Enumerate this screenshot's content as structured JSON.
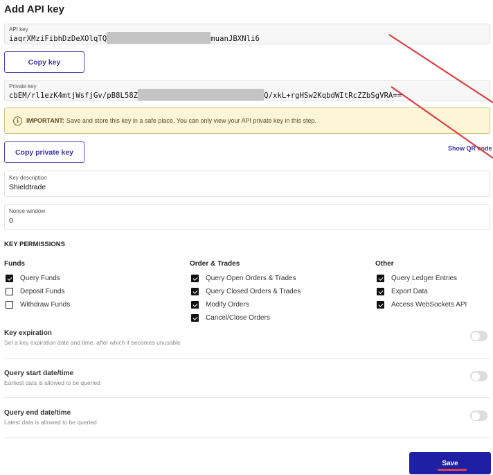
{
  "page": {
    "title": "Add API key"
  },
  "api_key": {
    "label": "API key",
    "value_start": "iaqrXMziFibhDzDeXOlqTQ",
    "value_end": "muanJBXNli6",
    "copy_button": "Copy key"
  },
  "private_key": {
    "label": "Private key",
    "value_start": "cbEM/rl1ezK4mtjWsfjGv/pB8L58Z",
    "value_end": "Q/xkL+rgHSw2KqbdWItRcZZbSgVRA==",
    "copy_button": "Copy private key"
  },
  "warning": {
    "icon": "info-icon",
    "strong": "IMPORTANT:",
    "text": "Save and store this key in a safe place. You can only view your API private key in this step."
  },
  "show_qr_link": "Show QR code",
  "key_description": {
    "label": "Key description",
    "value": "Shieldtrade"
  },
  "nonce_window": {
    "label": "Nonce window",
    "value": "0"
  },
  "permissions": {
    "heading": "KEY PERMISSIONS",
    "groups": [
      {
        "title": "Funds",
        "items": [
          {
            "label": "Query Funds",
            "checked": true
          },
          {
            "label": "Deposit Funds",
            "checked": false
          },
          {
            "label": "Withdraw Funds",
            "checked": false
          }
        ]
      },
      {
        "title": "Order & Trades",
        "items": [
          {
            "label": "Query Open Orders & Trades",
            "checked": true
          },
          {
            "label": "Query Closed Orders & Trades",
            "checked": true
          },
          {
            "label": "Modify Orders",
            "checked": true
          },
          {
            "label": "Cancel/Close Orders",
            "checked": true
          }
        ]
      },
      {
        "title": "Other",
        "items": [
          {
            "label": "Query Ledger Entries",
            "checked": true
          },
          {
            "label": "Export Data",
            "checked": true
          },
          {
            "label": "Access WebSockets API",
            "checked": true
          }
        ]
      }
    ]
  },
  "options": [
    {
      "title": "Key expiration",
      "description": "Set a key expiration date and time, after which it becomes unusable",
      "enabled": false
    },
    {
      "title": "Query start date/time",
      "description": "Earliest data is allowed to be queried",
      "enabled": false
    },
    {
      "title": "Query end date/time",
      "description": "Latest data is allowed to be queried",
      "enabled": false
    }
  ],
  "save_button": "Save",
  "colors": {
    "accent": "#1f1fa3",
    "link": "#3a33a3",
    "warning_bg": "#fdf5d8",
    "annotation": "#d94040"
  }
}
